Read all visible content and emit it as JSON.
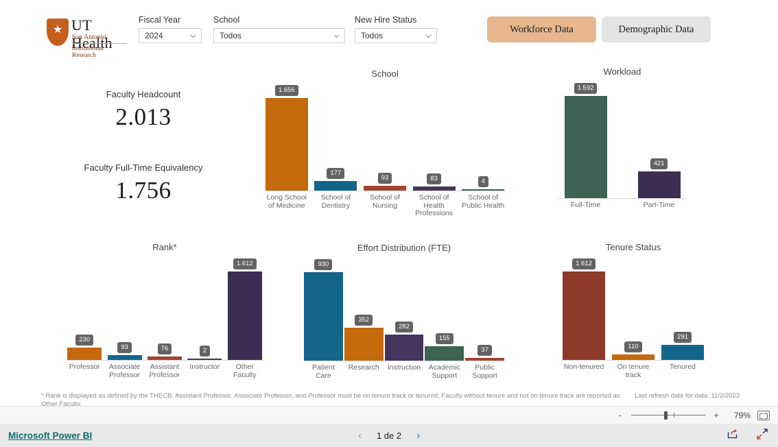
{
  "logo": {
    "line1": "UT Health",
    "line2": "San Antonio",
    "line3": "Institutional Research",
    "star_glyph": "★",
    "shield_color": "#c4601b"
  },
  "slicers": [
    {
      "name": "fiscal-year",
      "label": "Fiscal Year",
      "value": "2024"
    },
    {
      "name": "school",
      "label": "School",
      "value": "Todos"
    },
    {
      "name": "new-hire-status",
      "label": "New Hire Status",
      "value": "Todos"
    }
  ],
  "nav_buttons": [
    {
      "name": "workforce-data",
      "label": "Workforce Data",
      "active": true,
      "color": "#e6b78e"
    },
    {
      "name": "demographic-data",
      "label": "Demographic Data",
      "active": false,
      "color": "#e4e4e4"
    }
  ],
  "kpis": [
    {
      "name": "faculty-headcount",
      "title": "Faculty Headcount",
      "value": "2.013"
    },
    {
      "name": "faculty-fte",
      "title": "Faculty Full-Time Equivalency",
      "value": "1.756"
    }
  ],
  "footnote": "* Rank is displayed as defined by the THECB. Assistant Professor, Associate Professor, and Professor must be on tenure track or tenured. Faculty without tenure and not on tenure track are reported as Other Faculty.",
  "refresh_note": "Last refresh date for data: 11/2/2023",
  "zoom_bar": {
    "minus": "-",
    "plus": "+",
    "percent": "79%",
    "fit_icon": "fit-to-page-icon"
  },
  "footer": {
    "powerbi_link": "Microsoft Power BI",
    "prev_arrow": "‹",
    "next_arrow": "›",
    "page_text": "1 de 2",
    "share_icon": "share-icon",
    "fullscreen_icon": "fullscreen-icon"
  },
  "chart_data": [
    {
      "name": "school",
      "type": "bar",
      "title": "School",
      "xlabel": "",
      "ylabel": "",
      "ylim": [
        0,
        1656
      ],
      "grid": false,
      "legend": false,
      "categories": [
        "Long School\nof Medicine",
        "School of\nDentistry",
        "School of\nNursing",
        "School of\nHealth\nProfessions",
        "School of\nPublic Health"
      ],
      "values": [
        1656,
        177,
        93,
        83,
        4
      ],
      "labels": [
        "1.656",
        "177",
        "93",
        "83",
        "4"
      ],
      "colors": [
        "#c4690c",
        "#13658a",
        "#a1442c",
        "#45355e",
        "#3c6353"
      ]
    },
    {
      "name": "workload",
      "type": "bar",
      "title": "Workload",
      "xlabel": "",
      "ylabel": "",
      "ylim": [
        0,
        1592
      ],
      "grid": false,
      "legend": false,
      "categories": [
        "Full-Time",
        "Part-Time"
      ],
      "values": [
        1592,
        421
      ],
      "labels": [
        "1.592",
        "421"
      ],
      "colors": [
        "#3c6353",
        "#3b2e52"
      ]
    },
    {
      "name": "rank",
      "type": "bar",
      "title": "Rank*",
      "xlabel": "",
      "ylabel": "",
      "ylim": [
        0,
        1612
      ],
      "grid": false,
      "legend": false,
      "categories": [
        "Professor",
        "Associate\nProfessor",
        "Assistant\nProfessor",
        "Instructor",
        "Other\nFaculty"
      ],
      "values": [
        230,
        93,
        76,
        2,
        1612
      ],
      "labels": [
        "230",
        "93",
        "76",
        "2",
        "1.612"
      ],
      "colors": [
        "#c4690c",
        "#13658a",
        "#a1442c",
        "#45355e",
        "#3b2e52"
      ]
    },
    {
      "name": "effort-distribution",
      "type": "bar",
      "title": "Effort Distribution (FTE)",
      "xlabel": "",
      "ylabel": "",
      "ylim": [
        0,
        930
      ],
      "grid": false,
      "legend": false,
      "categories": [
        "Patient\nCare",
        "Research",
        "Instruction",
        "Academic\nSupport",
        "Public\nSupport"
      ],
      "values": [
        930,
        352,
        282,
        155,
        37
      ],
      "labels": [
        "930",
        "352",
        "282",
        "155",
        "37"
      ],
      "colors": [
        "#13658a",
        "#c4690c",
        "#45355e",
        "#3c6353",
        "#a1442c"
      ]
    },
    {
      "name": "tenure-status",
      "type": "bar",
      "title": "Tenure Status",
      "xlabel": "",
      "ylabel": "",
      "ylim": [
        0,
        1612
      ],
      "grid": false,
      "legend": false,
      "categories": [
        "Non-tenured",
        "On tenure\ntrack",
        "Tenured"
      ],
      "values": [
        1612,
        110,
        291
      ],
      "labels": [
        "1.612",
        "110",
        "291"
      ],
      "colors": [
        "#8e3a2b",
        "#c4690c",
        "#13658a"
      ]
    }
  ]
}
